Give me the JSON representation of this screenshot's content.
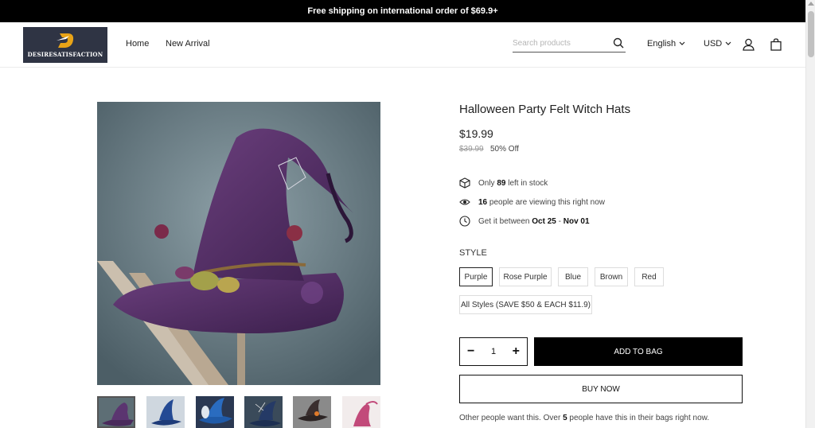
{
  "announcement": "Free shipping on international order of $69.9+",
  "header": {
    "logo_text": "DESIRESATISFACTION",
    "nav": {
      "home": "Home",
      "new_arrival": "New Arrival"
    },
    "search_placeholder": "Search products",
    "language": "English",
    "currency": "USD",
    "icons": [
      "search-icon",
      "chevron-down-icon",
      "user-icon",
      "bag-icon"
    ]
  },
  "product": {
    "title": "Halloween Party Felt Witch Hats",
    "price": "$19.99",
    "compare_price": "$39.99",
    "discount": "50% Off",
    "stock": {
      "pre": "Only",
      "count": "89",
      "post": "left in stock"
    },
    "viewers": {
      "count": "16",
      "post": "people are viewing this right now"
    },
    "delivery": {
      "pre": "Get it between",
      "start": "Oct 25",
      "sep": "-",
      "end": "Nov 01"
    },
    "style_label": "STYLE",
    "variants": [
      "Purple",
      "Rose Purple",
      "Blue",
      "Brown",
      "Red",
      "All Styles (SAVE $50 & EACH $11.9)"
    ],
    "selected_variant": "Purple",
    "quantity": "1",
    "qty_minus": "−",
    "qty_plus": "+",
    "add_to_bag": "ADD TO BAG",
    "buy_now": "BUY NOW",
    "others": {
      "pre": "Other people want this. Over",
      "count": "5",
      "post": "people have this in their bags right now."
    }
  },
  "colors": {
    "announcement_bg": "#000000",
    "logo_bg": "#2f3444",
    "logo_accent": "#e8a317",
    "button_primary": "#000000"
  }
}
